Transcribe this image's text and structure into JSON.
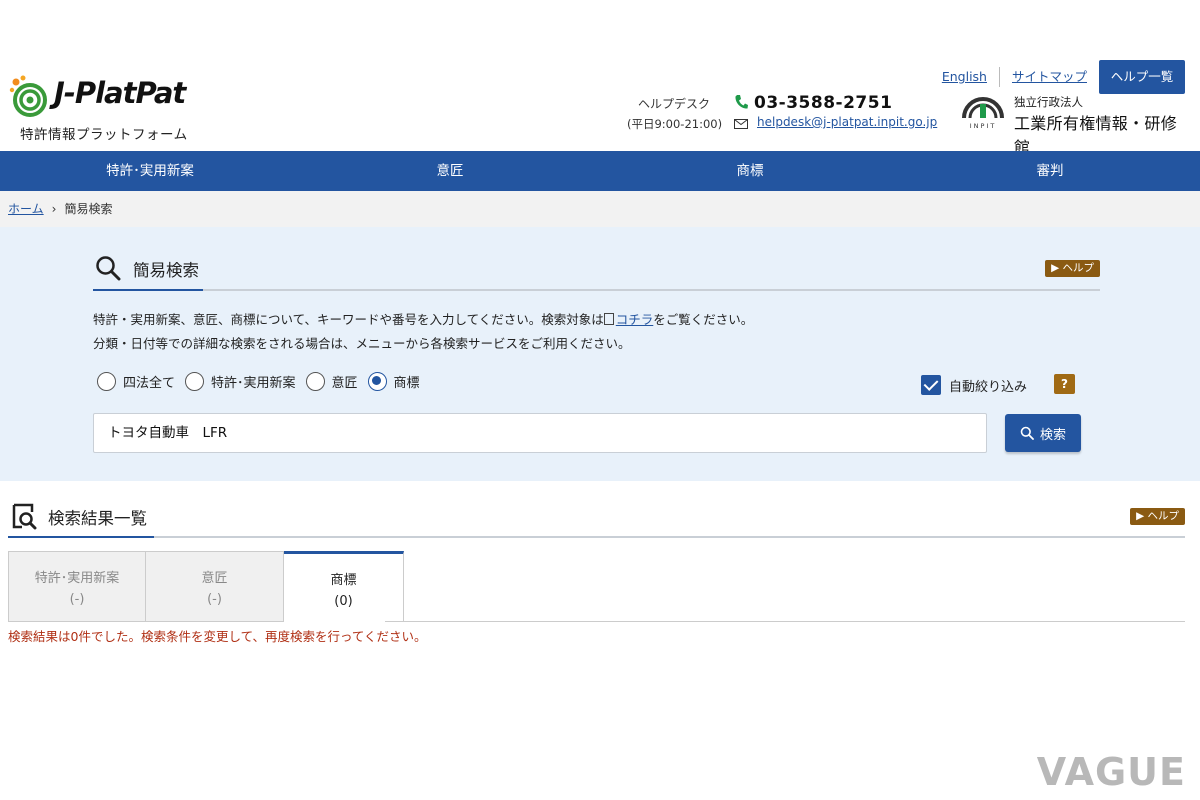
{
  "header": {
    "logo_text": "J-PlatPat",
    "logo_subtitle": "特許情報プラットフォーム",
    "links": {
      "english": "English",
      "sitemap": "サイトマップ"
    },
    "help_list_label": "ヘルプ一覧",
    "helpdesk": {
      "label": "ヘルプデスク",
      "hours": "(平日9:00-21:00)",
      "phone": "03-3588-2751",
      "email": "helpdesk@j-platpat.inpit.go.jp"
    },
    "org": {
      "sub": "独立行政法人",
      "name": "工業所有権情報・研修館",
      "mark_text": "INPIT"
    }
  },
  "nav": {
    "items": [
      "特許･実用新案",
      "意匠",
      "商標",
      "審判"
    ]
  },
  "breadcrumb": {
    "home": "ホーム",
    "separator": "›",
    "current": "簡易検索"
  },
  "search": {
    "title": "簡易検索",
    "help_label": "ヘルプ",
    "desc1_before": "特許・実用新案、意匠、商標について、キーワードや番号を入力してください。検索対象は",
    "desc1_link": "コチラ",
    "desc1_after": "をご覧ください。",
    "desc2": "分類・日付等での詳細な検索をされる場合は、メニューから各検索サービスをご利用ください。",
    "radios": [
      {
        "label": "四法全て",
        "selected": false
      },
      {
        "label": "特許･実用新案",
        "selected": false
      },
      {
        "label": "意匠",
        "selected": false
      },
      {
        "label": "商標",
        "selected": true
      }
    ],
    "auto_filter_label": "自動絞り込み",
    "auto_filter_checked": true,
    "question_label": "?",
    "input_value": "トヨタ自動車　LFR",
    "button_label": "検索"
  },
  "results": {
    "title": "検索結果一覧",
    "help_label": "ヘルプ",
    "tabs": [
      {
        "label": "特許･実用新案",
        "count": "(-)",
        "active": false
      },
      {
        "label": "意匠",
        "count": "(-)",
        "active": false
      },
      {
        "label": "商標",
        "count": "(0)",
        "active": true
      }
    ],
    "message": "検索結果は0件でした。検索条件を変更して、再度検索を行ってください。"
  },
  "watermark": "VAGUE",
  "colors": {
    "primary": "#2355a0",
    "help_badge": "#8a5a12",
    "panel_bg": "#e8f1fa",
    "error": "#b03015"
  }
}
